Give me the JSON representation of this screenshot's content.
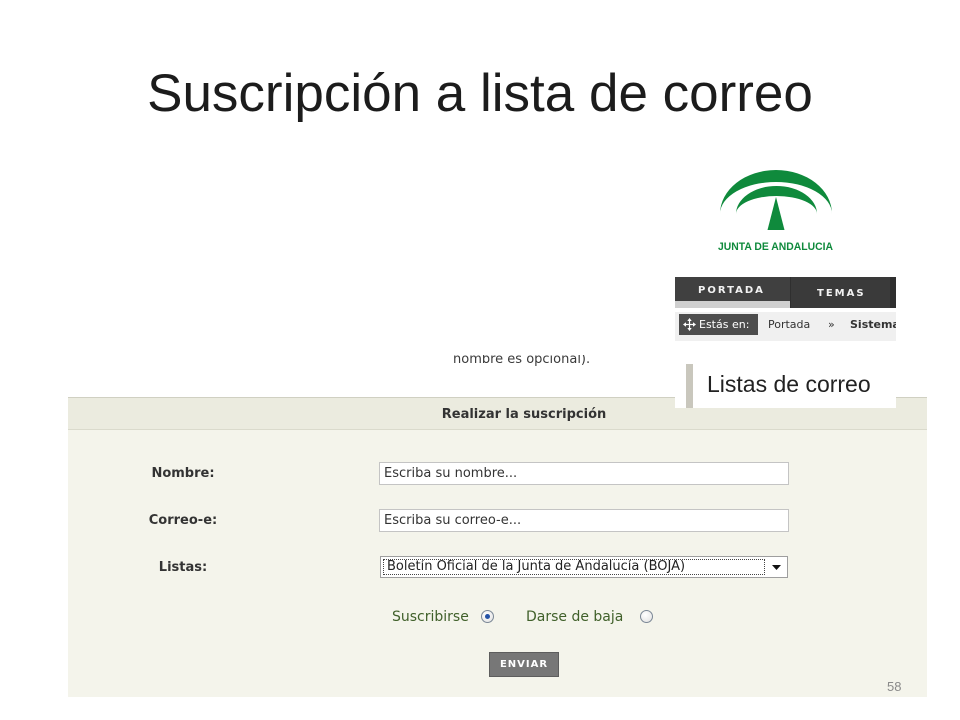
{
  "slide": {
    "title": "Suscripción a lista de correo",
    "page_number": "58"
  },
  "logo": {
    "text": "JUNTA DE ANDALUCIA",
    "icon": "junta-de-andalucia-logo"
  },
  "nav": {
    "tabs": [
      {
        "label": "PORTADA",
        "active": true
      },
      {
        "label": "TEMAS",
        "active": false
      }
    ]
  },
  "breadcrumb": {
    "prefix": "Estás en:",
    "icon": "move-arrows-icon",
    "items": [
      "Portada",
      "Sistema"
    ],
    "separator": "»"
  },
  "intro_fragment": "nombre es opcional).",
  "section_heading": "Listas de correo",
  "form": {
    "title": "Realizar la suscripción",
    "fields": {
      "nombre": {
        "label": "Nombre:",
        "value": "Escriba su nombre..."
      },
      "correo": {
        "label": "Correo-e:",
        "value": "Escriba su correo-e..."
      },
      "listas": {
        "label": "Listas:",
        "selected": "Boletín Oficial de la Junta de Andalucía (BOJA)",
        "icon": "chevron-down-icon"
      }
    },
    "radios": [
      {
        "label": "Suscribirse",
        "checked": true
      },
      {
        "label": "Darse de baja",
        "checked": false
      }
    ],
    "submit_label": "ENVIAR"
  },
  "colors": {
    "logo_green": "#0f8a3c",
    "nav_dark": "#404040",
    "form_background": "#f4f4eb",
    "radio_label": "#40602a",
    "radio_selected": "#2452a6",
    "button_background": "#777777"
  }
}
